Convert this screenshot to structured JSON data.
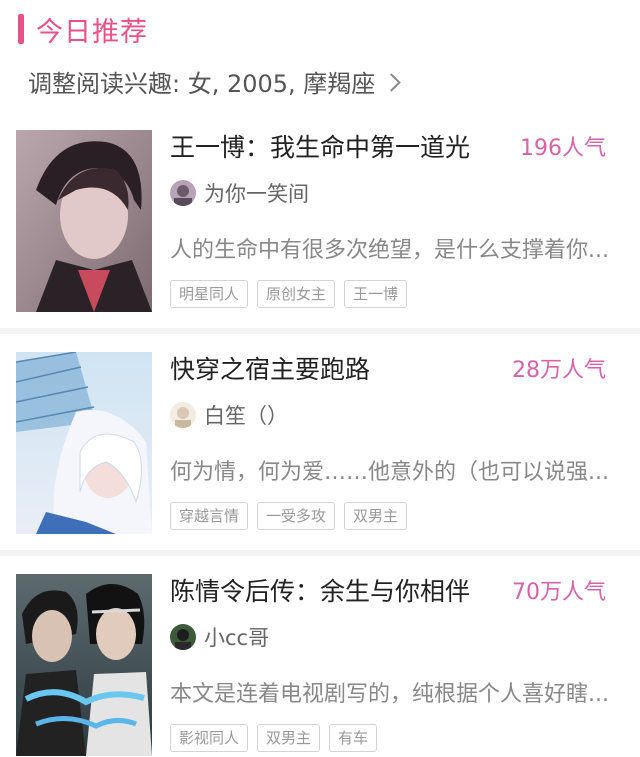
{
  "colors": {
    "accent": "#e8528a",
    "popularity": "#d563a8"
  },
  "header": {
    "section_title": "今日推荐",
    "interest_text": "调整阅读兴趣: 女, 2005, 摩羯座"
  },
  "books": [
    {
      "title": "王一博：我生命中第一道光",
      "popularity": "196人气",
      "author": "为你一笑间",
      "description": "人的生命中有很多次绝望，是什么支撑着你...",
      "tags": [
        "明星同人",
        "原创女主",
        "王一博"
      ]
    },
    {
      "title": "快穿之宿主要跑路",
      "popularity": "28万人气",
      "author": "白笙（）",
      "description": "何为情，何为爱……他意外的（也可以说强...",
      "tags": [
        "穿越言情",
        "一受多攻",
        "双男主"
      ]
    },
    {
      "title": "陈情令后传：余生与你相伴",
      "popularity": "70万人气",
      "author": "小cc哥",
      "description": "本文是连着电视剧写的，纯根据个人喜好瞎...",
      "tags": [
        "影视同人",
        "双男主",
        "有车"
      ]
    }
  ]
}
